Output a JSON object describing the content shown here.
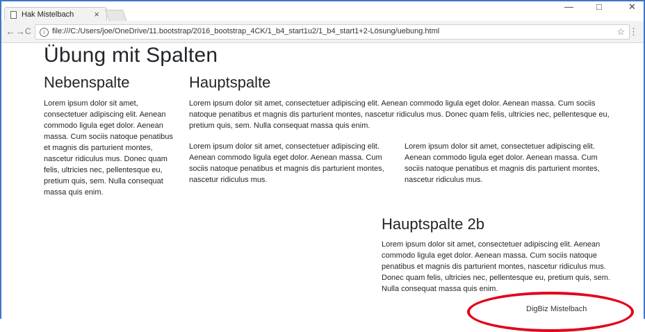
{
  "browser": {
    "tab_title": "Hak Mistelbach",
    "tab_close": "×",
    "url": "file:///C:/Users/joe/OneDrive/11.bootstrap/2016_bootstrap_4CK/1_b4_start1u2/1_b4_start1+2-Lösung/uebung.html",
    "back": "←",
    "forward": "→",
    "reload": "C",
    "star": "☆",
    "menu": "⋮",
    "minimize": "—",
    "maximize": "□",
    "close": "✕"
  },
  "page": {
    "title": "Übung mit Spalten",
    "nebenspalte": {
      "heading": "Nebenspalte",
      "text": "Lorem ipsum dolor sit amet, consectetuer adipiscing elit. Aenean commodo ligula eget dolor. Aenean massa. Cum sociis natoque penatibus et magnis dis parturient montes, nascetur ridiculus mus. Donec quam felis, ultricies nec, pellentesque eu, pretium quis, sem. Nulla consequat massa quis enim."
    },
    "hauptspalte": {
      "heading": "Hauptspalte",
      "text": "Lorem ipsum dolor sit amet, consectetuer adipiscing elit. Aenean commodo ligula eget dolor. Aenean massa. Cum sociis natoque penatibus et magnis dis parturient montes, nascetur ridiculus mus. Donec quam felis, ultricies nec, pellentesque eu, pretium quis, sem. Nulla consequat massa quis enim.",
      "sub1": "Lorem ipsum dolor sit amet, consectetuer adipiscing elit. Aenean commodo ligula eget dolor. Aenean massa. Cum sociis natoque penatibus et magnis dis parturient montes, nascetur ridiculus mus.",
      "sub2": "Lorem ipsum dolor sit amet, consectetuer adipiscing elit. Aenean commodo ligula eget dolor. Aenean massa. Cum sociis natoque penatibus et magnis dis parturient montes, nascetur ridiculus mus."
    },
    "hauptspalte2b": {
      "heading": "Hauptspalte 2b",
      "text": "Lorem ipsum dolor sit amet, consectetuer adipiscing elit. Aenean commodo ligula eget dolor. Aenean massa. Cum sociis natoque penatibus et magnis dis parturient montes, nascetur ridiculus mus. Donec quam felis, ultricies nec, pellentesque eu, pretium quis, sem. Nulla consequat massa quis enim."
    },
    "footer": "DigBiz Mistelbach"
  },
  "colors": {
    "annotation": "#e3001b",
    "window_frame": "#3b78c8"
  }
}
